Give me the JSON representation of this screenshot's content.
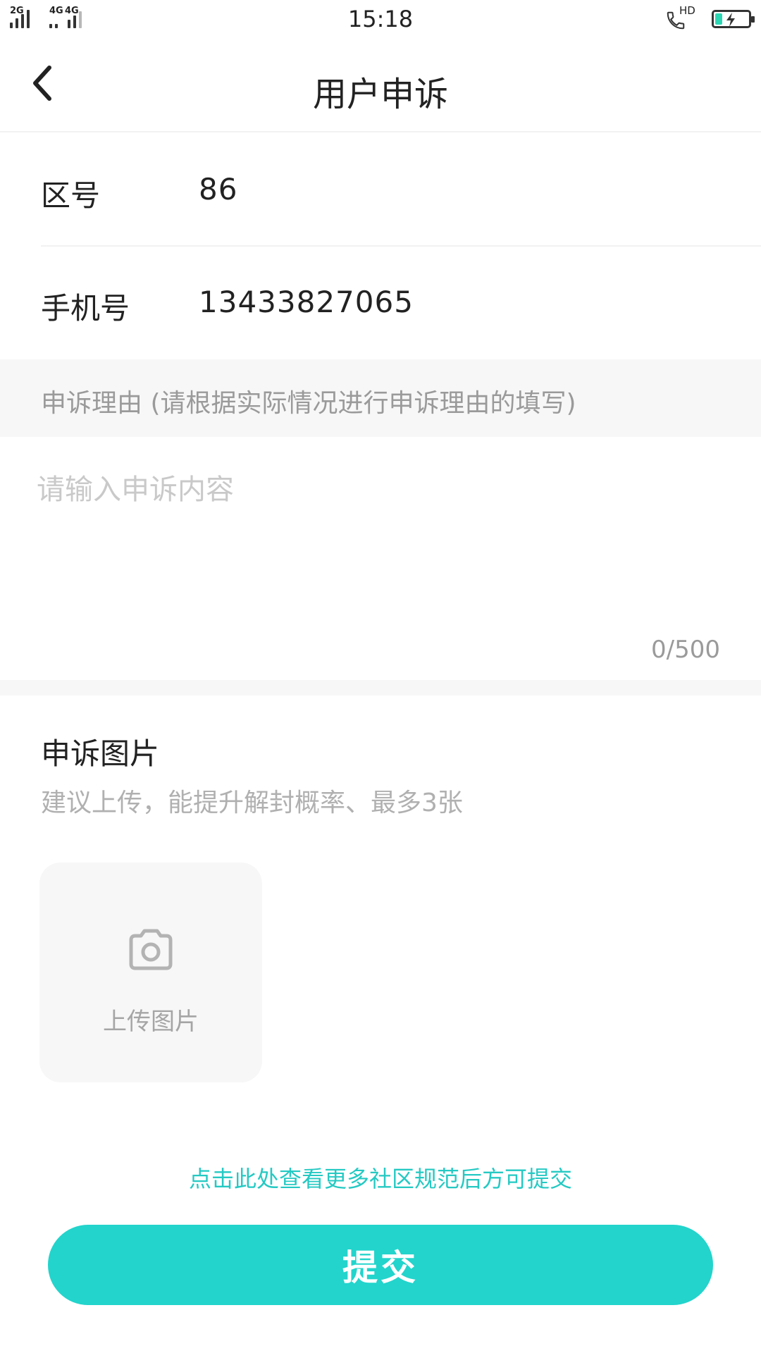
{
  "status_bar": {
    "time": "15:18",
    "network_1": "2G",
    "network_2": "4G",
    "network_3": "4G",
    "call_hd": "HD",
    "battery_charging": true,
    "icons": [
      "signal-icon",
      "hd-call-icon",
      "battery-charging-icon"
    ]
  },
  "header": {
    "title": "用户申诉",
    "back_icon": "chevron-left-icon"
  },
  "form": {
    "area_code": {
      "label": "区号",
      "value": "86"
    },
    "phone": {
      "label": "手机号",
      "value": "13433827065"
    },
    "reason": {
      "section_label": "申诉理由 (请根据实际情况进行申诉理由的填写)",
      "placeholder": "请输入申诉内容",
      "value": "",
      "counter": "0/500"
    },
    "photos": {
      "title": "申诉图片",
      "hint": "建议上传，能提升解封概率、最多3张",
      "upload_label": "上传图片",
      "upload_icon": "camera-icon"
    }
  },
  "footer": {
    "rules_link": "点击此处查看更多社区规范后方可提交",
    "submit_label": "提交"
  },
  "colors": {
    "accent": "#22d4cc",
    "link": "#25c9c3",
    "section_bg": "#f7f7f7",
    "muted_text": "#9a9a9a"
  }
}
